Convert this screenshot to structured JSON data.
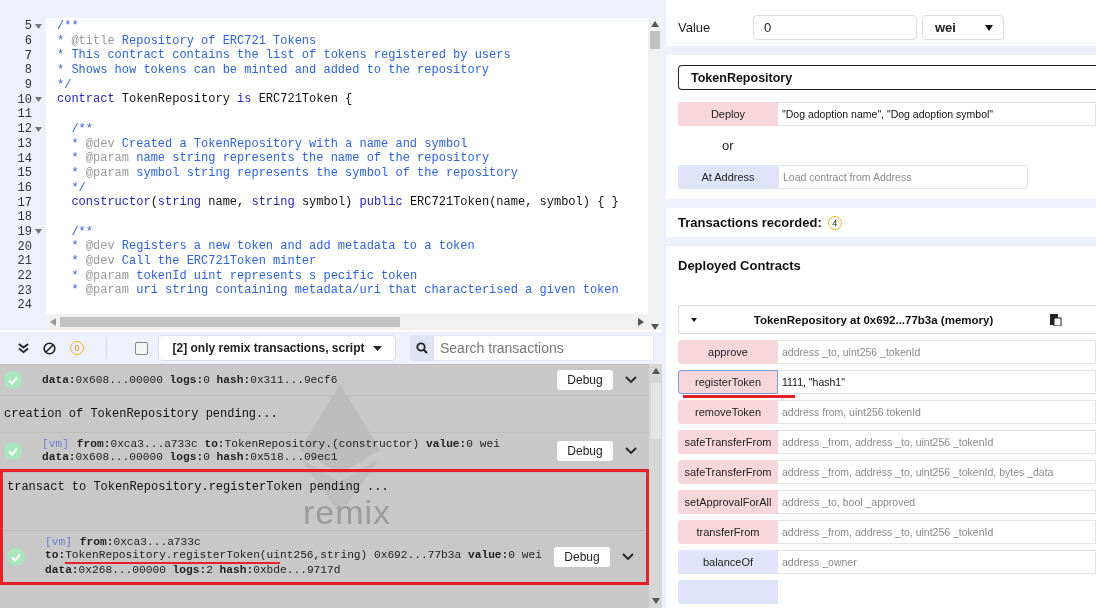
{
  "editor": {
    "lines": [
      {
        "n": "5",
        "fold": true,
        "tokens": [
          {
            "kind": "comment",
            "text": "/**"
          }
        ]
      },
      {
        "n": "6",
        "fold": false,
        "tokens": [
          {
            "kind": "comment",
            "text": "* "
          },
          {
            "kind": "tag",
            "text": "@title"
          },
          {
            "kind": "comment",
            "text": " Repository of ERC721 Tokens"
          }
        ]
      },
      {
        "n": "7",
        "fold": false,
        "tokens": [
          {
            "kind": "comment",
            "text": "* This contract contains the list of tokens registered by users"
          }
        ]
      },
      {
        "n": "8",
        "fold": false,
        "tokens": [
          {
            "kind": "comment",
            "text": "* Shows how tokens can be minted and added to the repository"
          }
        ]
      },
      {
        "n": "9",
        "fold": false,
        "tokens": [
          {
            "kind": "comment",
            "text": "*/"
          }
        ]
      },
      {
        "n": "10",
        "fold": true,
        "tokens": [
          {
            "kind": "keyword",
            "text": "contract"
          },
          {
            "kind": "plain",
            "text": " TokenRepository "
          },
          {
            "kind": "keyword",
            "text": "is"
          },
          {
            "kind": "plain",
            "text": " ERC721Token {"
          }
        ]
      },
      {
        "n": "11",
        "fold": false
      },
      {
        "n": "12",
        "fold": true,
        "tokens": [
          {
            "kind": "comment",
            "text": "  /**"
          }
        ]
      },
      {
        "n": "13",
        "fold": false,
        "tokens": [
          {
            "kind": "comment",
            "text": "  * "
          },
          {
            "kind": "tag",
            "text": "@dev"
          },
          {
            "kind": "comment",
            "text": " Created a TokenRepository with a name and symbol"
          }
        ]
      },
      {
        "n": "14",
        "fold": false,
        "tokens": [
          {
            "kind": "comment",
            "text": "  * "
          },
          {
            "kind": "tag",
            "text": "@param"
          },
          {
            "kind": "comment",
            "text": " name string represents the name of the repository"
          }
        ]
      },
      {
        "n": "15",
        "fold": false,
        "tokens": [
          {
            "kind": "comment",
            "text": "  * "
          },
          {
            "kind": "tag",
            "text": "@param"
          },
          {
            "kind": "comment",
            "text": " symbol string represents the symbol of the repository"
          }
        ]
      },
      {
        "n": "16",
        "fold": false,
        "tokens": [
          {
            "kind": "comment",
            "text": "  */"
          }
        ]
      },
      {
        "n": "17",
        "fold": false,
        "tokens": [
          {
            "kind": "keyword",
            "text": "  constructor"
          },
          {
            "kind": "plain",
            "text": "("
          },
          {
            "kind": "keyword",
            "text": "string"
          },
          {
            "kind": "plain",
            "text": " name, "
          },
          {
            "kind": "keyword",
            "text": "string"
          },
          {
            "kind": "plain",
            "text": " symbol) "
          },
          {
            "kind": "keyword",
            "text": "public"
          },
          {
            "kind": "plain",
            "text": " ERC721Token(name, symbol) { }"
          }
        ]
      },
      {
        "n": "18",
        "fold": false
      },
      {
        "n": "19",
        "fold": true,
        "tokens": [
          {
            "kind": "comment",
            "text": "  /**"
          }
        ]
      },
      {
        "n": "20",
        "fold": false,
        "tokens": [
          {
            "kind": "comment",
            "text": "  * "
          },
          {
            "kind": "tag",
            "text": "@dev"
          },
          {
            "kind": "comment",
            "text": " Registers a new token and add metadata to a token"
          }
        ]
      },
      {
        "n": "21",
        "fold": false,
        "tokens": [
          {
            "kind": "comment",
            "text": "  * "
          },
          {
            "kind": "tag",
            "text": "@dev"
          },
          {
            "kind": "comment",
            "text": " Call the ERC721Token minter"
          }
        ]
      },
      {
        "n": "22",
        "fold": false,
        "tokens": [
          {
            "kind": "comment",
            "text": "  * "
          },
          {
            "kind": "tag",
            "text": "@param"
          },
          {
            "kind": "comment",
            "text": " tokenId uint represents s pecific token"
          }
        ]
      },
      {
        "n": "23",
        "fold": false,
        "tokens": [
          {
            "kind": "comment",
            "text": "  * "
          },
          {
            "kind": "tag",
            "text": "@param"
          },
          {
            "kind": "comment",
            "text": " uri string containing metadata/uri that characterised a given token"
          }
        ]
      },
      {
        "n": "24",
        "fold": false
      }
    ]
  },
  "terminal": {
    "pending_count": "0",
    "filter_checked": false,
    "filter": "[2] only remix transactions, script",
    "search": {
      "placeholder": "Search transactions"
    },
    "background_logo": "remix",
    "entries": [
      {
        "kind": "tx",
        "highlighted": false,
        "lines": [
          "**data:**0x608...00000 **logs:**0 **hash:**0x311...9ecf6"
        ],
        "button": "Debug",
        "underlined": false
      },
      {
        "kind": "status",
        "highlighted": false,
        "text": "creation of TokenRepository pending..."
      },
      {
        "kind": "tx",
        "highlighted": false,
        "tag": "[vm]",
        "lines": [
          "**from:**0xca3...a733c **to:**TokenRepository.(constructor) **value:**0 wei",
          "**data:**0x608...00000 **logs:**0 **hash:**0x518...09ec1"
        ],
        "button": "Debug",
        "underlined": false
      },
      {
        "kind": "status",
        "highlighted": true,
        "text": "transact to TokenRepository.registerToken pending ..."
      },
      {
        "kind": "tx",
        "highlighted": true,
        "tag": "[vm]",
        "lines": [
          "**from:**0xca3...a733c",
          "**to:**TokenRepository.registerToken(uint256,string) 0x692...77b3a **value:**0 wei",
          "**data:**0x268...00000 **logs:**2 **hash:**0xbde...9717d"
        ],
        "button": "Debug",
        "underlined": true
      }
    ]
  },
  "run": {
    "value_label": "Value",
    "value": "0",
    "unit": "wei",
    "contract_select": "TokenRepository",
    "deploy": {
      "label": "Deploy",
      "value": "\"Dog adoption name\", \"Dog adoption symbol\""
    },
    "or": "or",
    "at_address": {
      "label": "At Address",
      "placeholder": "Load contract from Address"
    },
    "transactions_recorded": {
      "label": "Transactions recorded:",
      "count": "4"
    },
    "deployed": {
      "title": "Deployed Contracts",
      "instance": {
        "title": "TokenRepository at 0x692...77b3a (memory)",
        "expanded": true,
        "functions": [
          {
            "name": "approve",
            "kind": "transact",
            "placeholder": "address _to, uint256 _tokenId",
            "selected": false,
            "underlined": false
          },
          {
            "name": "registerToken",
            "kind": "transact",
            "value": "1111, \"hash1\"",
            "selected": true,
            "underlined": true
          },
          {
            "name": "removeToken",
            "kind": "transact",
            "placeholder": "address from, uint256 tokenId",
            "selected": false,
            "underlined": false
          },
          {
            "name": "safeTransferFrom",
            "kind": "transact",
            "placeholder": "address _from, address _to, uint256 _tokenId",
            "selected": false,
            "underlined": false
          },
          {
            "name": "safeTransferFrom",
            "kind": "transact",
            "placeholder": "address _from, address _to, uint256 _tokenId, bytes _data",
            "selected": false,
            "underlined": false
          },
          {
            "name": "setApprovalForAll",
            "kind": "transact",
            "placeholder": "address _to, bool _approved",
            "selected": false,
            "underlined": false
          },
          {
            "name": "transferFrom",
            "kind": "transact",
            "placeholder": "address _from, address _to, uint256 _tokenId",
            "selected": false,
            "underlined": false
          },
          {
            "name": "balanceOf",
            "kind": "call",
            "placeholder": "address _owner",
            "selected": false,
            "underlined": false
          }
        ]
      }
    }
  }
}
